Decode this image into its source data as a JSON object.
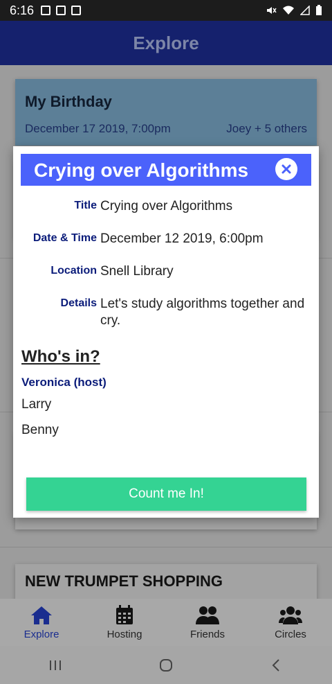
{
  "status_bar": {
    "time": "6:16"
  },
  "app_bar": {
    "title": "Explore"
  },
  "background": {
    "event_card": {
      "title": "My Birthday",
      "date": "December 17 2019, 7:00pm",
      "people": "Joey + 5 others"
    },
    "lower_card": {
      "title": "NEW TRUMPET SHOPPING"
    }
  },
  "modal": {
    "header_title": "Crying over Algorithms",
    "rows": [
      {
        "label": "Title",
        "value": "Crying over Algorithms"
      },
      {
        "label": "Date & Time",
        "value": "December 12 2019, 6:00pm"
      },
      {
        "label": "Location",
        "value": "Snell Library"
      },
      {
        "label": "Details",
        "value": "Let's study algorithms together and cry."
      }
    ],
    "whos_in_heading": "Who's in?",
    "host": "Veronica (host)",
    "members": [
      "Larry",
      "Benny"
    ],
    "action_button": "Count me In!"
  },
  "bottom_nav": {
    "items": [
      {
        "label": "Explore",
        "icon": "home-icon",
        "active": true
      },
      {
        "label": "Hosting",
        "icon": "calendar-icon",
        "active": false
      },
      {
        "label": "Friends",
        "icon": "users-icon",
        "active": false
      },
      {
        "label": "Circles",
        "icon": "group-icon",
        "active": false
      }
    ]
  },
  "colors": {
    "app_bar": "#15216d",
    "modal_header": "#4b62fb",
    "label_text": "#0b1c7a",
    "action_button": "#34d393",
    "active_nav": "#1a2d8f"
  }
}
